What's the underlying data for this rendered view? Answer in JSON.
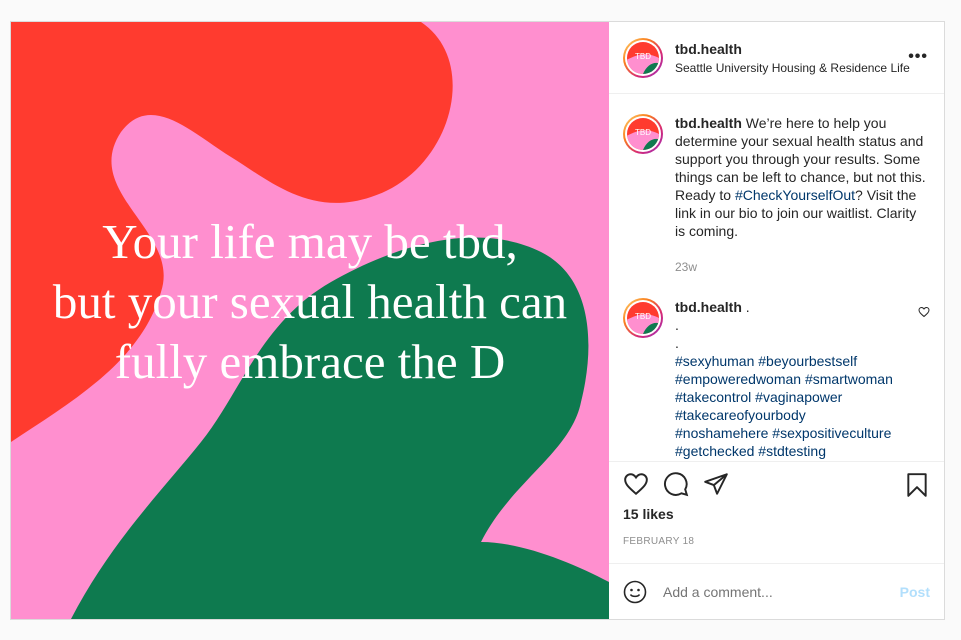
{
  "post": {
    "image_text": [
      "Your life may be tbd,",
      "but your sexual health can",
      "fully embrace the D"
    ],
    "colors": {
      "pink": "#ff8fcf",
      "red": "#ff3b2f",
      "green": "#0e7a4f"
    }
  },
  "header": {
    "username": "tbd.health",
    "location": "Seattle University Housing & Residence Life",
    "more_label": "•••",
    "avatar_text": "TBD"
  },
  "caption": {
    "username": "tbd.health",
    "text_before": " We’re here to help you determine your sexual health status and support you through your results. Some things can be left to chance, but not this. Ready to ",
    "hashtag": "#CheckYourselfOut",
    "text_after": "? Visit the link in our bio to join our waitlist. Clarity is coming.",
    "time": "23w"
  },
  "comment2": {
    "username": "tbd.health",
    "suffix": " .",
    "dots": [
      ".",
      "."
    ],
    "hashtag_lines": [
      "#sexyhuman #beyourbestself",
      "#empoweredwoman #smartwoman",
      "#takecontrol #vaginapower",
      "#takecareofyourbody",
      "#noshamehere #sexpositiveculture",
      "#getchecked #stdtesting"
    ]
  },
  "actions": {
    "icons": [
      "heart-icon",
      "comment-icon",
      "share-icon",
      "bookmark-icon"
    ]
  },
  "likes": "15 likes",
  "date": "FEBRUARY 18",
  "add_comment": {
    "placeholder": "Add a comment...",
    "post_label": "Post"
  }
}
